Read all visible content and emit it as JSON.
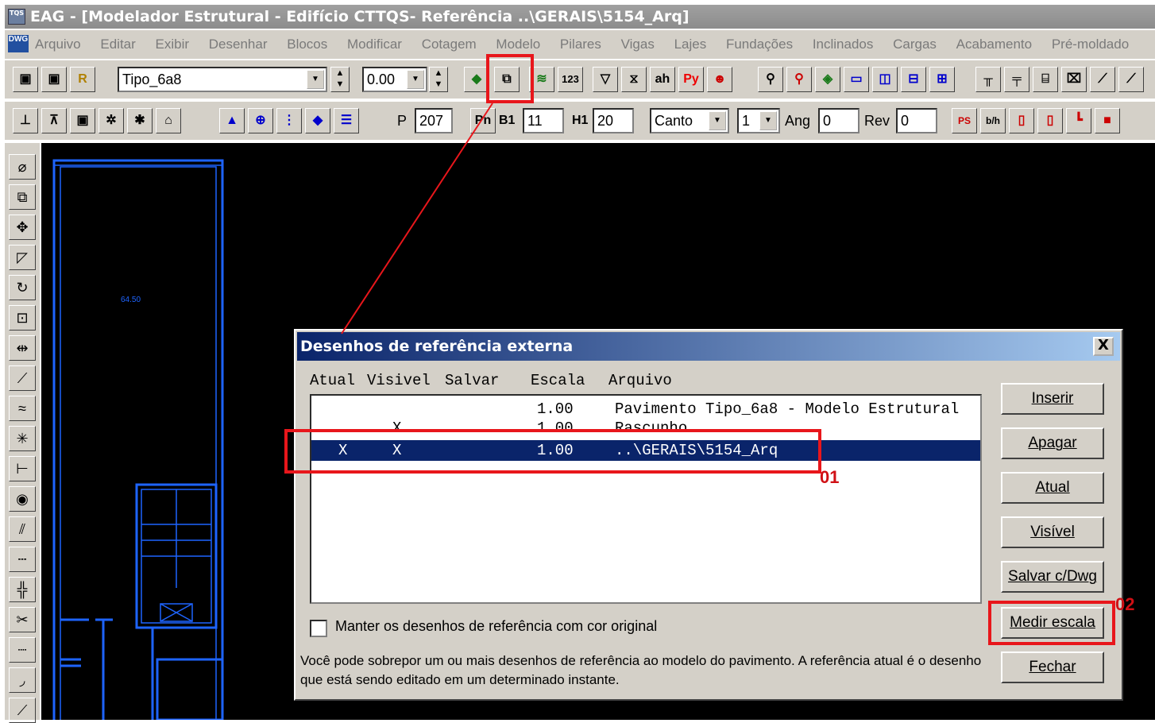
{
  "window": {
    "title": "EAG - [Modelador Estrutural - Edifício CTTQS- Referência ..\\GERAIS\\5154_Arq]",
    "app_icon": "tqs-app-icon"
  },
  "menu": {
    "dwg_icon": "DWG",
    "items": [
      "Arquivo",
      "Editar",
      "Exibir",
      "Desenhar",
      "Blocos",
      "Modificar",
      "Cotagem",
      "Modelo",
      "Pilares",
      "Vigas",
      "Lajes",
      "Fundações",
      "Inclinados",
      "Cargas",
      "Acabamento",
      "Pré-moldado"
    ]
  },
  "toolbar1": {
    "floor_combo": "Tipo_6a8",
    "level_combo": "0.00",
    "btn_r": "R",
    "btn_123": "123",
    "btn_ah": "ah",
    "btn_py": "Py"
  },
  "toolbar2": {
    "p_label": "P",
    "p_value": "207",
    "pn_label": "Pn",
    "b1_label": "B1",
    "b1_value": "11",
    "h1_label": "H1",
    "h1_value": "20",
    "canto_combo": "Canto",
    "num_combo": "1",
    "ang_label": "Ang",
    "ang_value": "0",
    "rev_label": "Rev",
    "rev_value": "0",
    "btn_ps": "PS",
    "btn_bh": "b/h"
  },
  "drawing": {
    "room_label": "64.50"
  },
  "dialog": {
    "title": "Desenhos de referência externa",
    "close": "X",
    "columns": {
      "atual": "Atual",
      "visivel": "Visivel",
      "salvar": "Salvar",
      "escala": "Escala",
      "arquivo": "Arquivo"
    },
    "rows": [
      {
        "atual": "",
        "visivel": "",
        "salvar": "",
        "escala": "1.00",
        "arquivo": "Pavimento Tipo_6a8 - Modelo Estrutural"
      },
      {
        "atual": "",
        "visivel": "X",
        "salvar": "",
        "escala": "1.00",
        "arquivo": "Rascunho"
      },
      {
        "atual": "X",
        "visivel": "X",
        "salvar": "",
        "escala": "1.00",
        "arquivo": "..\\GERAIS\\5154_Arq"
      }
    ],
    "selected_row": 2,
    "buttons": {
      "inserir": "Inserir",
      "apagar": "Apagar",
      "atual": "Atual",
      "visivel": "Visível",
      "salvar": "Salvar c/Dwg",
      "medir": "Medir escala",
      "fechar": "Fechar"
    },
    "checkbox_label": "Manter os desenhos de referência com cor original",
    "checkbox_checked": false,
    "help_text": "Você pode sobrepor um ou mais desenhos de referência ao modelo do pavimento. A referência atual é o desenho que está sendo editado em um determinado instante."
  },
  "annotations": {
    "label_01": "01",
    "label_02": "02",
    "color": "#e8161b"
  },
  "colors": {
    "canvas": "#000000",
    "cad_lines": "#1e64ff",
    "dialog_title": "#0a246a",
    "chrome": "#d4d0c8"
  }
}
